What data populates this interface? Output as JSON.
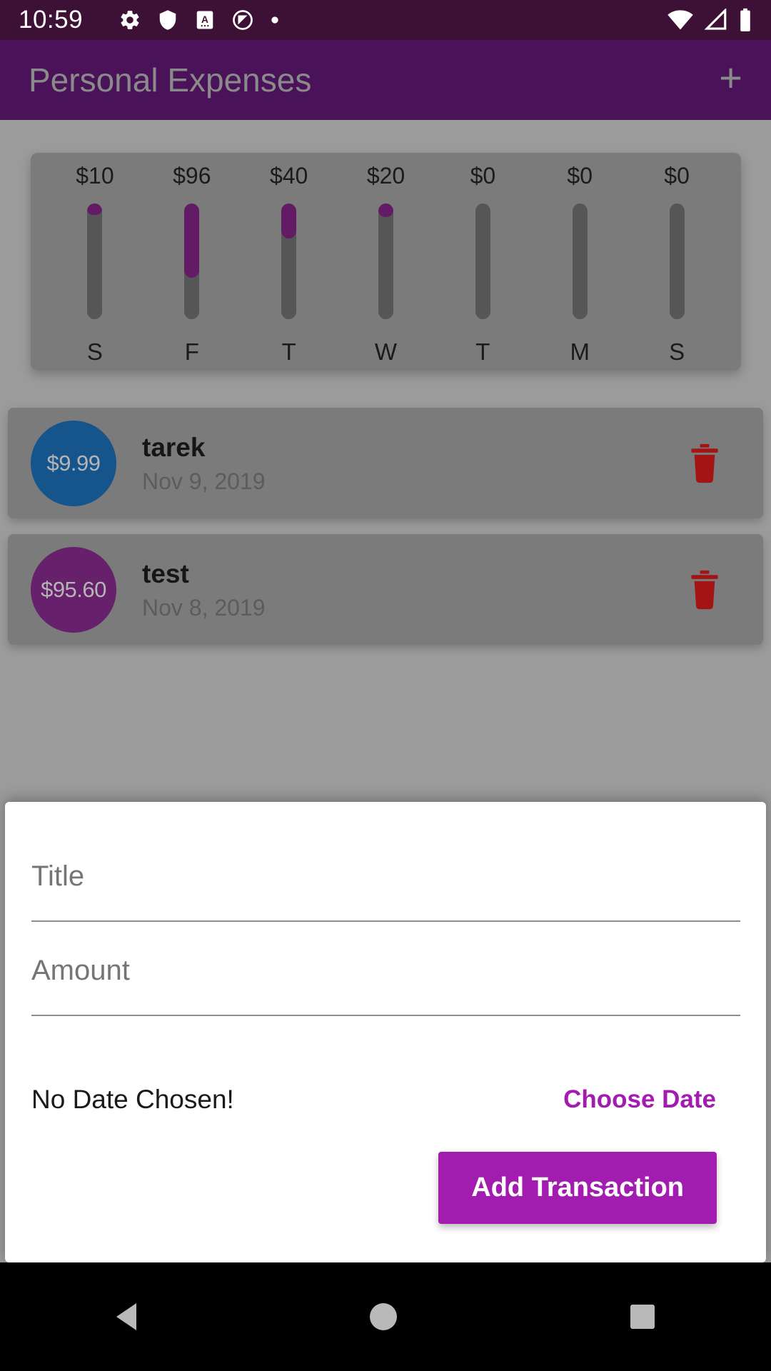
{
  "status_bar": {
    "clock": "10:59",
    "left_icons": [
      "gear-icon",
      "shield-icon",
      "letter-a-box-icon",
      "do-not-disturb-icon",
      "dot-icon"
    ],
    "right_icons": [
      "wifi-icon",
      "cellular-signal-icon",
      "battery-icon"
    ],
    "background_color": "#3D1035"
  },
  "app_bar": {
    "title": "Personal Expenses",
    "add_icon": "plus-icon",
    "background_color": "#4A1259"
  },
  "chart_data": {
    "type": "bar",
    "title": "Weekly spending chart",
    "categories": [
      "S",
      "F",
      "T",
      "W",
      "T",
      "M",
      "S"
    ],
    "value_labels": [
      "$10",
      "$96",
      "$40",
      "$20",
      "$0",
      "$0",
      "$0"
    ],
    "values": [
      9.99,
      95.6,
      40,
      20,
      0,
      0,
      0
    ],
    "fill_fraction": [
      0.1,
      0.64,
      0.3,
      0.12,
      0,
      0,
      0
    ],
    "xlabel": "",
    "ylabel": "",
    "grid": false,
    "legend": "none",
    "bar_color": "#631B65",
    "track_color": "#565656"
  },
  "transactions": {
    "items": [
      {
        "amount": "$9.99",
        "title": "tarek",
        "date": "Nov 9, 2019",
        "avatar_color": "#15558c",
        "delete_icon": "trash-icon"
      },
      {
        "amount": "$95.60",
        "title": "test",
        "date": "Nov 8, 2019",
        "avatar_color": "#67206b",
        "delete_icon": "trash-icon"
      }
    ]
  },
  "new_transaction_sheet": {
    "title_field": {
      "label": "Title",
      "value": "",
      "placeholder": "Title"
    },
    "amount_field": {
      "label": "Amount",
      "value": "",
      "placeholder": "Amount"
    },
    "date_status": "No Date Chosen!",
    "choose_date_label": "Choose Date",
    "submit_label": "Add Transaction",
    "accent_color": "#A31CB0"
  },
  "nav_bar": {
    "back_icon": "back-triangle-icon",
    "home_icon": "home-circle-icon",
    "recents_icon": "recents-square-icon"
  }
}
